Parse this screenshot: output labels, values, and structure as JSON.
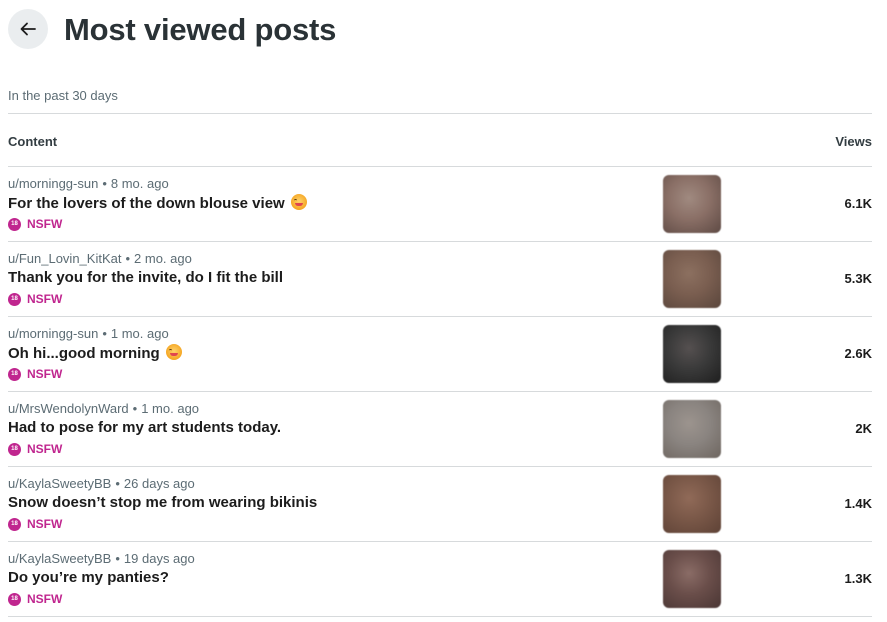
{
  "header": {
    "title": "Most viewed posts",
    "subtitle": "In the past 30 days"
  },
  "table": {
    "col_content": "Content",
    "col_views": "Views"
  },
  "icons": {
    "back": "arrow-left-icon",
    "nsfw": "nsfw-badge-icon",
    "emoji": "face-savoring-food-emoji"
  },
  "colors": {
    "nsfw": "#c0268f",
    "divider": "#d7dadc"
  },
  "rows": [
    {
      "author": "u/morningg-sun",
      "age": "8 mo. ago",
      "title": "For the lovers of the down blouse view",
      "has_emoji": true,
      "nsfw": "NSFW",
      "views": "6.1K",
      "thumb_colors": [
        "#8a6f66",
        "#5e4a44",
        "#a08a80"
      ]
    },
    {
      "author": "u/Fun_Lovin_KitKat",
      "age": "2 mo. ago",
      "title": "Thank you for the invite, do I fit the bill",
      "has_emoji": false,
      "nsfw": "NSFW",
      "views": "5.3K",
      "thumb_colors": [
        "#7a5e50",
        "#5a463c",
        "#8c7060"
      ]
    },
    {
      "author": "u/morningg-sun",
      "age": "1 mo. ago",
      "title": "Oh hi...good morning",
      "has_emoji": true,
      "nsfw": "NSFW",
      "views": "2.6K",
      "thumb_colors": [
        "#3a3a3a",
        "#1e1e1e",
        "#555050"
      ]
    },
    {
      "author": "u/MrsWendolynWard",
      "age": "1 mo. ago",
      "title": "Had to pose for my art students today.",
      "has_emoji": false,
      "nsfw": "NSFW",
      "views": "2K",
      "thumb_colors": [
        "#8a8480",
        "#6e6660",
        "#9c948e"
      ]
    },
    {
      "author": "u/KaylaSweetyBB",
      "age": "26 days ago",
      "title": "Snow doesn’t stop me from wearing bikinis",
      "has_emoji": false,
      "nsfw": "NSFW",
      "views": "1.4K",
      "thumb_colors": [
        "#7a5848",
        "#5e4236",
        "#906a58"
      ]
    },
    {
      "author": "u/KaylaSweetyBB",
      "age": "19 days ago",
      "title": "Do you’re my panties?",
      "has_emoji": false,
      "nsfw": "NSFW",
      "views": "1.3K",
      "thumb_colors": [
        "#6a4e4a",
        "#4a3634",
        "#8a6c66"
      ]
    }
  ]
}
